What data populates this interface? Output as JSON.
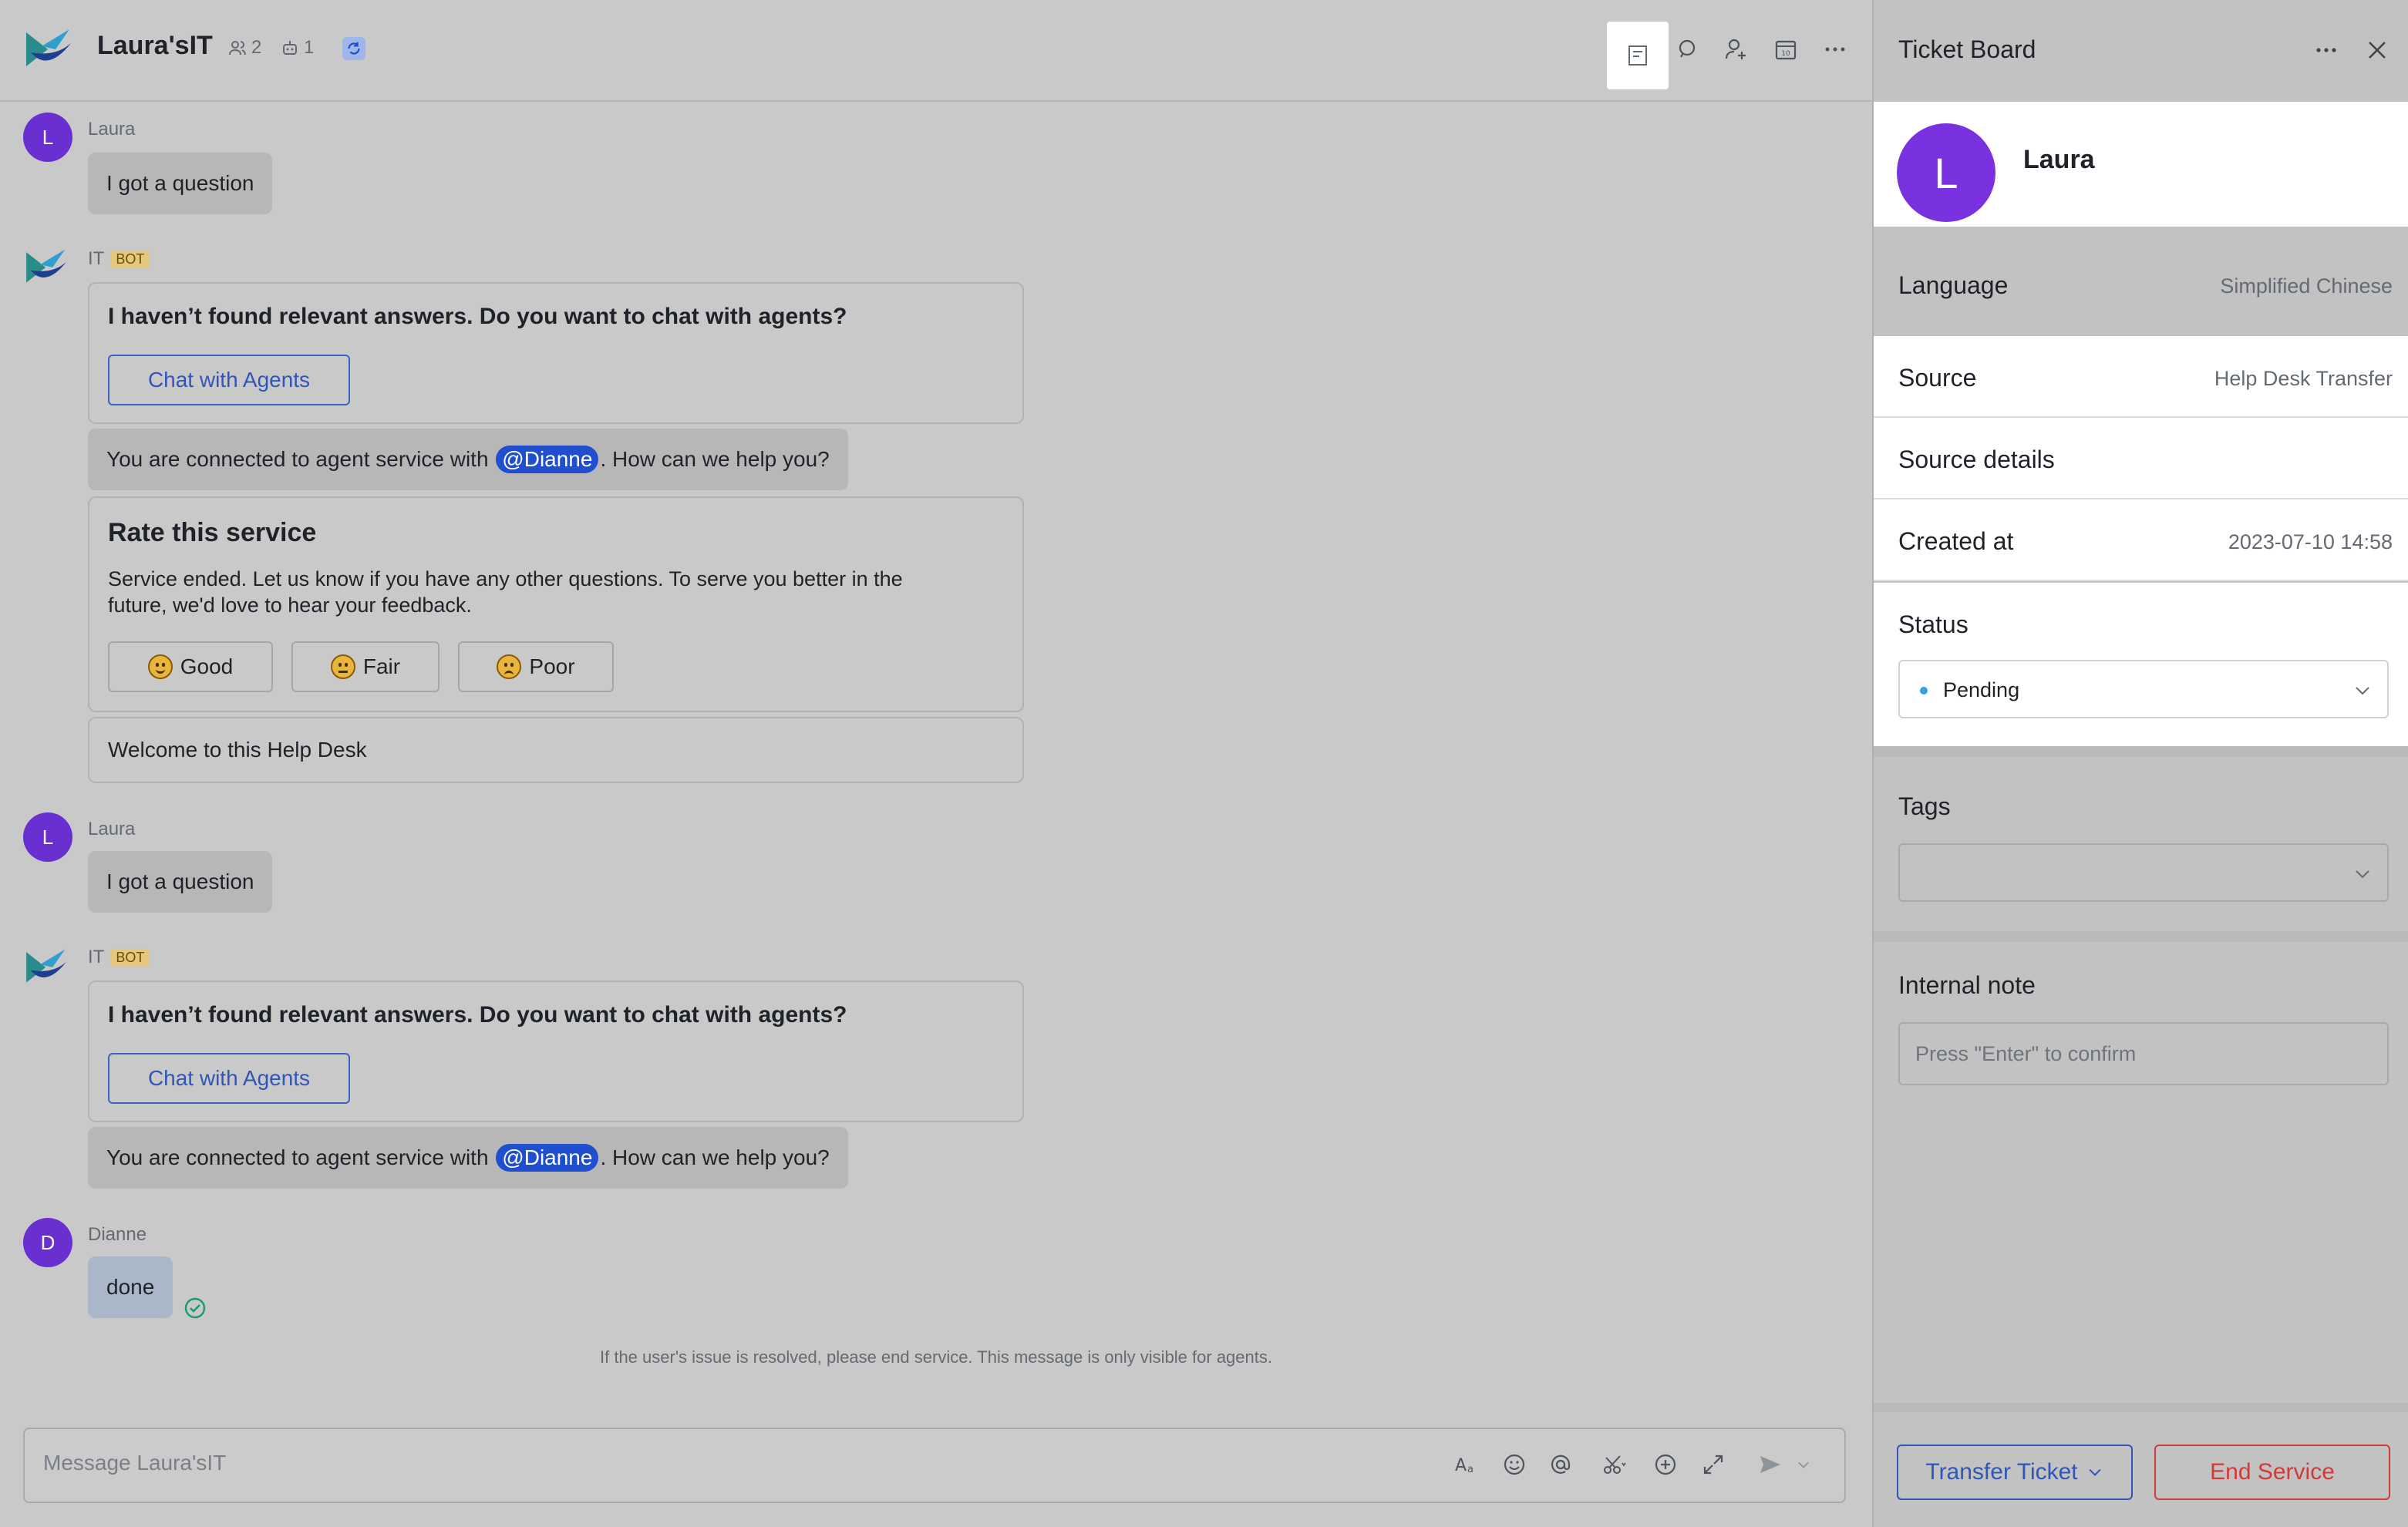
{
  "header": {
    "title": "Laura'sIT",
    "member_count": "2",
    "bot_count": "1",
    "icons": [
      "ticket-icon",
      "search-icon",
      "add-member-icon",
      "calendar-icon",
      "more-icon"
    ]
  },
  "messages": {
    "m1": {
      "avatar": "L",
      "sender": "Laura",
      "text": "I got a question"
    },
    "m2": {
      "sender": "IT",
      "badge": "BOT",
      "card_title": "I haven’t found relevant answers. Do you want to chat with agents?",
      "button": "Chat with Agents",
      "connected_pre": "You are connected to agent service with",
      "mention": "@Dianne",
      "connected_post": ". How can we help you?",
      "rate_title": "Rate this service",
      "rate_body_1": "Service ended. Let us know if you have any other questions. To serve you better in the",
      "rate_body_2": "future, we'd love to hear your feedback.",
      "rate_good": "Good",
      "rate_fair": "Fair",
      "rate_poor": "Poor",
      "welcome": "Welcome to this Help Desk"
    },
    "m3": {
      "avatar": "L",
      "sender": "Laura",
      "text": "I got a question"
    },
    "m4": {
      "sender": "IT",
      "badge": "BOT",
      "card_title": "I haven’t found relevant answers. Do you want to chat with agents?",
      "button": "Chat with Agents",
      "connected_pre": "You are connected to agent service with",
      "mention": "@Dianne",
      "connected_post": ". How can we help you?"
    },
    "m5": {
      "avatar": "D",
      "sender": "Dianne",
      "text": "done"
    }
  },
  "agent_hint": "If the user's issue is resolved, please end service. This message is only visible for agents.",
  "composer": {
    "placeholder": "Message Laura'sIT",
    "tools": [
      "text-format-icon",
      "emoji-icon",
      "mention-icon",
      "scissors-icon",
      "add-icon",
      "expand-icon",
      "send-icon"
    ]
  },
  "panel": {
    "title": "Ticket Board",
    "profile": {
      "avatar": "L",
      "name": "Laura"
    },
    "language": {
      "label": "Language",
      "value": "Simplified Chinese"
    },
    "source": {
      "label": "Source",
      "value": "Help Desk Transfer"
    },
    "source_details": {
      "label": "Source details"
    },
    "created_at": {
      "label": "Created at",
      "value": "2023-07-10 14:58"
    },
    "status": {
      "label": "Status",
      "value": "Pending"
    },
    "tags": {
      "label": "Tags"
    },
    "internal_note": {
      "label": "Internal note",
      "placeholder": "Press \"Enter\" to confirm"
    },
    "transfer_button": "Transfer Ticket",
    "end_button": "End Service"
  },
  "colors": {
    "accent": "#2f56b8",
    "danger": "#d23a3a",
    "avatar": "#6a2fd1",
    "status_dot": "#2ea1e8"
  }
}
